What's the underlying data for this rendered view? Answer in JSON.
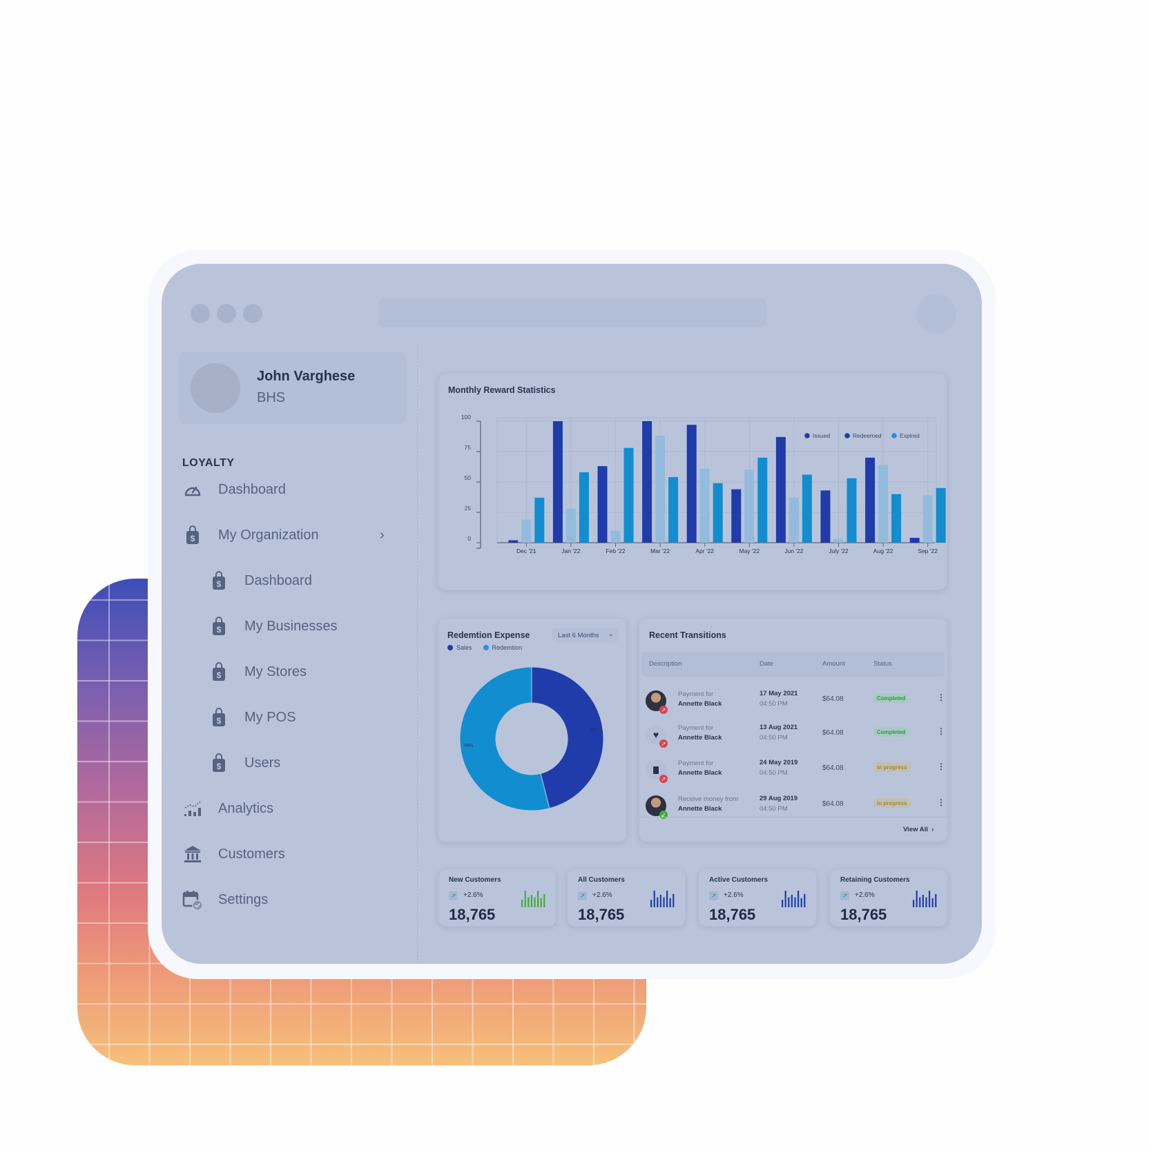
{
  "window": {
    "url_bar": ""
  },
  "profile": {
    "name": "John Varghese",
    "org": "BHS"
  },
  "sidebar": {
    "section_label": "LOYALTY",
    "items": [
      {
        "label": "Dashboard",
        "icon": "gauge-icon"
      },
      {
        "label": "My Organization",
        "icon": "shopping-bag-dollar-icon",
        "has_chevron": true
      },
      {
        "label": "Dashboard",
        "icon": "shopping-bag-dollar-icon",
        "sub": true
      },
      {
        "label": "My Businesses",
        "icon": "shopping-bag-dollar-icon",
        "sub": true
      },
      {
        "label": "My Stores",
        "icon": "shopping-bag-dollar-icon",
        "sub": true
      },
      {
        "label": "My POS",
        "icon": "shopping-bag-dollar-icon",
        "sub": true
      },
      {
        "label": "Users",
        "icon": "shopping-bag-dollar-icon",
        "sub": true
      },
      {
        "label": "Analytics",
        "icon": "analytics-icon"
      },
      {
        "label": "Customers",
        "icon": "bank-icon"
      },
      {
        "label": "Settings",
        "icon": "calendar-check-icon"
      }
    ]
  },
  "colors": {
    "issued": "#1f3caa",
    "redeemed": "#93bbdd",
    "expired": "#128dd0",
    "sales": "#1f3caa",
    "redemtion": "#128dd0",
    "completed_text": "#2e9a3f",
    "progress_text": "#a8882f"
  },
  "chart_data": [
    {
      "type": "bar",
      "title": "Monthly Reward Statistics",
      "xlabel": "",
      "ylabel": "",
      "ylim": [
        0,
        100
      ],
      "yticks": [
        0,
        25,
        50,
        75,
        100
      ],
      "grid": true,
      "legend_position": "top-right",
      "categories": [
        "Dec '21",
        "Jan '22",
        "Feb '22",
        "Mar '22",
        "Apr '22",
        "May '22",
        "Jun '22",
        "July '22",
        "Aug '22",
        "Sep '22"
      ],
      "series": [
        {
          "name": "Issued",
          "values": [
            2,
            100,
            63,
            100,
            97,
            44,
            87,
            43,
            70,
            4
          ]
        },
        {
          "name": "Redeemed",
          "values": [
            19,
            28,
            10,
            88,
            61,
            60,
            37,
            3,
            64,
            39
          ]
        },
        {
          "name": "Expired",
          "values": [
            37,
            58,
            78,
            54,
            49,
            70,
            56,
            53,
            40,
            45
          ]
        }
      ]
    },
    {
      "type": "pie",
      "title": "Redemtion Expense",
      "donut": true,
      "legend_position": "top-left",
      "categories": [
        "Sales",
        "Redemtion"
      ],
      "values": [
        46,
        54
      ],
      "labels": [
        "46%",
        "54%"
      ]
    }
  ],
  "redemption": {
    "dropdown_value": "Last 6 Months"
  },
  "transactions": {
    "title": "Recent Transitions",
    "columns": [
      "Description",
      "Date",
      "Amount",
      "Status"
    ],
    "rows": [
      {
        "avatar": "person-photo",
        "direction": "out",
        "line1": "Payment for",
        "line2": "Annette Black",
        "date": "17 May 2021",
        "time": "04:50 PM",
        "amount": "$64.08",
        "status": "Completed"
      },
      {
        "avatar": "heart-icon",
        "direction": "out",
        "line1": "Payment for",
        "line2": "Annette Black",
        "date": "13 Aug 2021",
        "time": "04:50 PM",
        "amount": "$64.08",
        "status": "Completed"
      },
      {
        "avatar": "book-icon",
        "direction": "out",
        "line1": "Payment for",
        "line2": "Annette Black",
        "date": "24 May 2019",
        "time": "04:50 PM",
        "amount": "$64.08",
        "status": "In progress"
      },
      {
        "avatar": "person-photo",
        "direction": "in",
        "line1": "Receive money from",
        "line2": "Annette Black",
        "date": "29 Aug 2019",
        "time": "04:50 PM",
        "amount": "$64.08",
        "status": "In progress"
      }
    ],
    "view_all": "View All"
  },
  "stats": [
    {
      "label": "New Customers",
      "change": "+2.6%",
      "value": "18,765",
      "spark_color": "#3fae3a",
      "spark": [
        0.45,
        1.0,
        0.6,
        0.75,
        0.6,
        1.0,
        0.55,
        0.8
      ]
    },
    {
      "label": "All Customers",
      "change": "+2.6%",
      "value": "18,765",
      "spark_color": "#1f3caa",
      "spark": [
        0.45,
        1.0,
        0.6,
        0.75,
        0.6,
        1.0,
        0.55,
        0.8
      ]
    },
    {
      "label": "Active Customers",
      "change": "+2.6%",
      "value": "18,765",
      "spark_color": "#1f3caa",
      "spark": [
        0.45,
        1.0,
        0.6,
        0.75,
        0.6,
        1.0,
        0.55,
        0.8
      ]
    },
    {
      "label": "Retaining Customers",
      "change": "+2.6%",
      "value": "18,765",
      "spark_color": "#1f3caa",
      "spark": [
        0.45,
        1.0,
        0.6,
        0.75,
        0.6,
        1.0,
        0.55,
        0.8
      ]
    }
  ]
}
